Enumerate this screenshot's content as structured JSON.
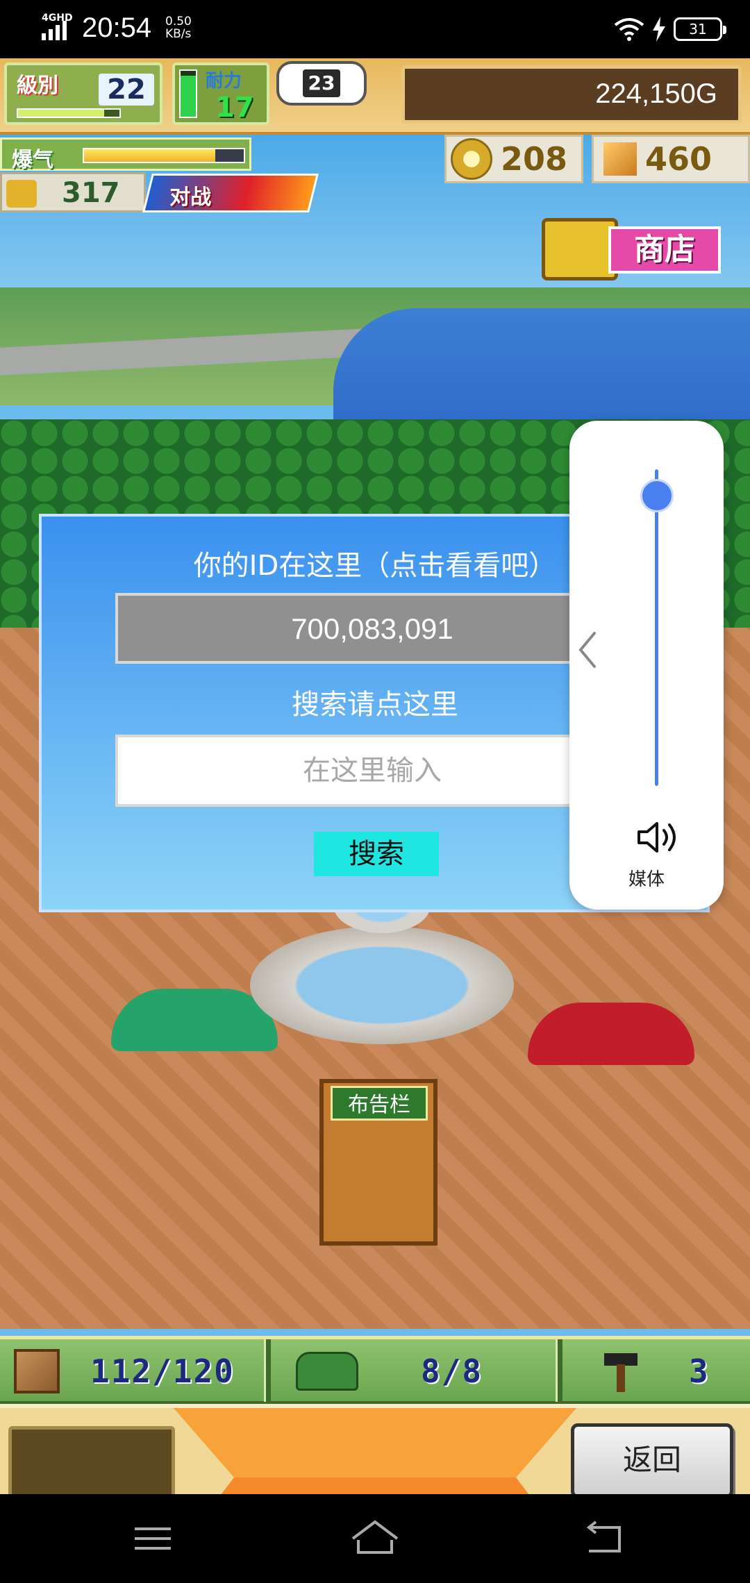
{
  "status_bar": {
    "network": "4GHD",
    "time": "20:54",
    "speed_value": "0.50",
    "speed_unit": "KB/s",
    "battery": "31"
  },
  "hud": {
    "level_label": "級別",
    "level": "22",
    "level_progress": 0.85,
    "stamina_label": "耐力",
    "stamina": "17",
    "stamina_fill": 0.9,
    "bubble_value": "23",
    "gold": "224,150G",
    "hype_label": "爆气",
    "hype_fill": 0.82,
    "medals": "317",
    "battle_label": "对战",
    "coins": "208",
    "cubes": "460",
    "shop_label": "商店"
  },
  "dialog": {
    "title": "你的ID在这里（点击看看吧）",
    "id_value": "700,083,091",
    "search_hint": "搜索请点这里",
    "input_placeholder": "在这里输入",
    "search_button": "搜索"
  },
  "volume_panel": {
    "level": 0.97,
    "label": "媒体"
  },
  "scene": {
    "board_label": "布告栏"
  },
  "bottom_hud": {
    "items": "112/120",
    "robots": "8/8",
    "hammers": "3"
  },
  "command": {
    "back_button": "返回"
  },
  "colors": {
    "dialog_top": "#3a90ee",
    "search_button": "#1fe6e0",
    "volume_accent": "#4a7ff0"
  }
}
